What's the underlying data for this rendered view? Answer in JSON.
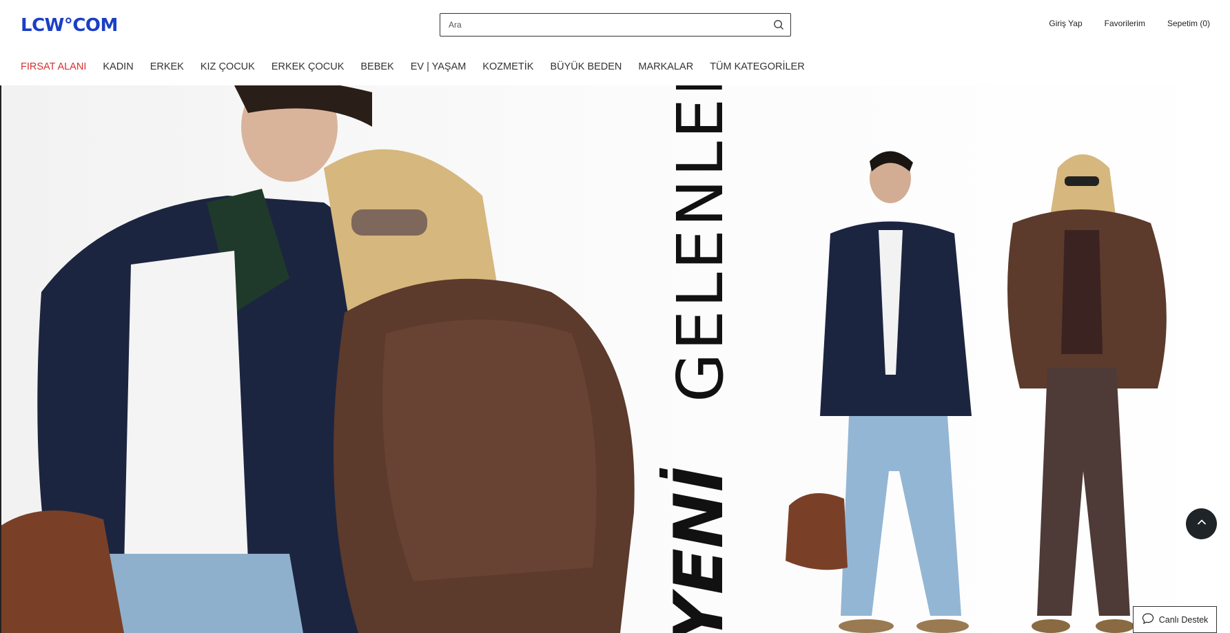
{
  "header": {
    "logo_text": "LCW°COM",
    "brand_color": "#1a3fc5"
  },
  "search": {
    "placeholder": "Ara",
    "value": ""
  },
  "user_links": {
    "login": "Giriş Yap",
    "favorites": "Favorilerim",
    "cart": "Sepetim (0)"
  },
  "nav": {
    "items": [
      {
        "label": "FIRSAT ALANI",
        "highlight": true
      },
      {
        "label": "KADIN"
      },
      {
        "label": "ERKEK"
      },
      {
        "label": "KIZ ÇOCUK"
      },
      {
        "label": "ERKEK ÇOCUK"
      },
      {
        "label": "BEBEK"
      },
      {
        "label": "EV | YAŞAM"
      },
      {
        "label": "KOZMETİK"
      },
      {
        "label": "BÜYÜK BEDEN"
      },
      {
        "label": "MARKALAR"
      },
      {
        "label": "TÜM KATEGORİLER"
      }
    ],
    "highlight_color": "#d62f2f"
  },
  "hero": {
    "headline_bold": "YENİ",
    "headline_light": "GELENLER"
  },
  "floating": {
    "scroll_top_icon": "chevron-up-icon",
    "live_support_label": "Canlı Destek",
    "live_support_icon": "chat-bubble-icon"
  }
}
